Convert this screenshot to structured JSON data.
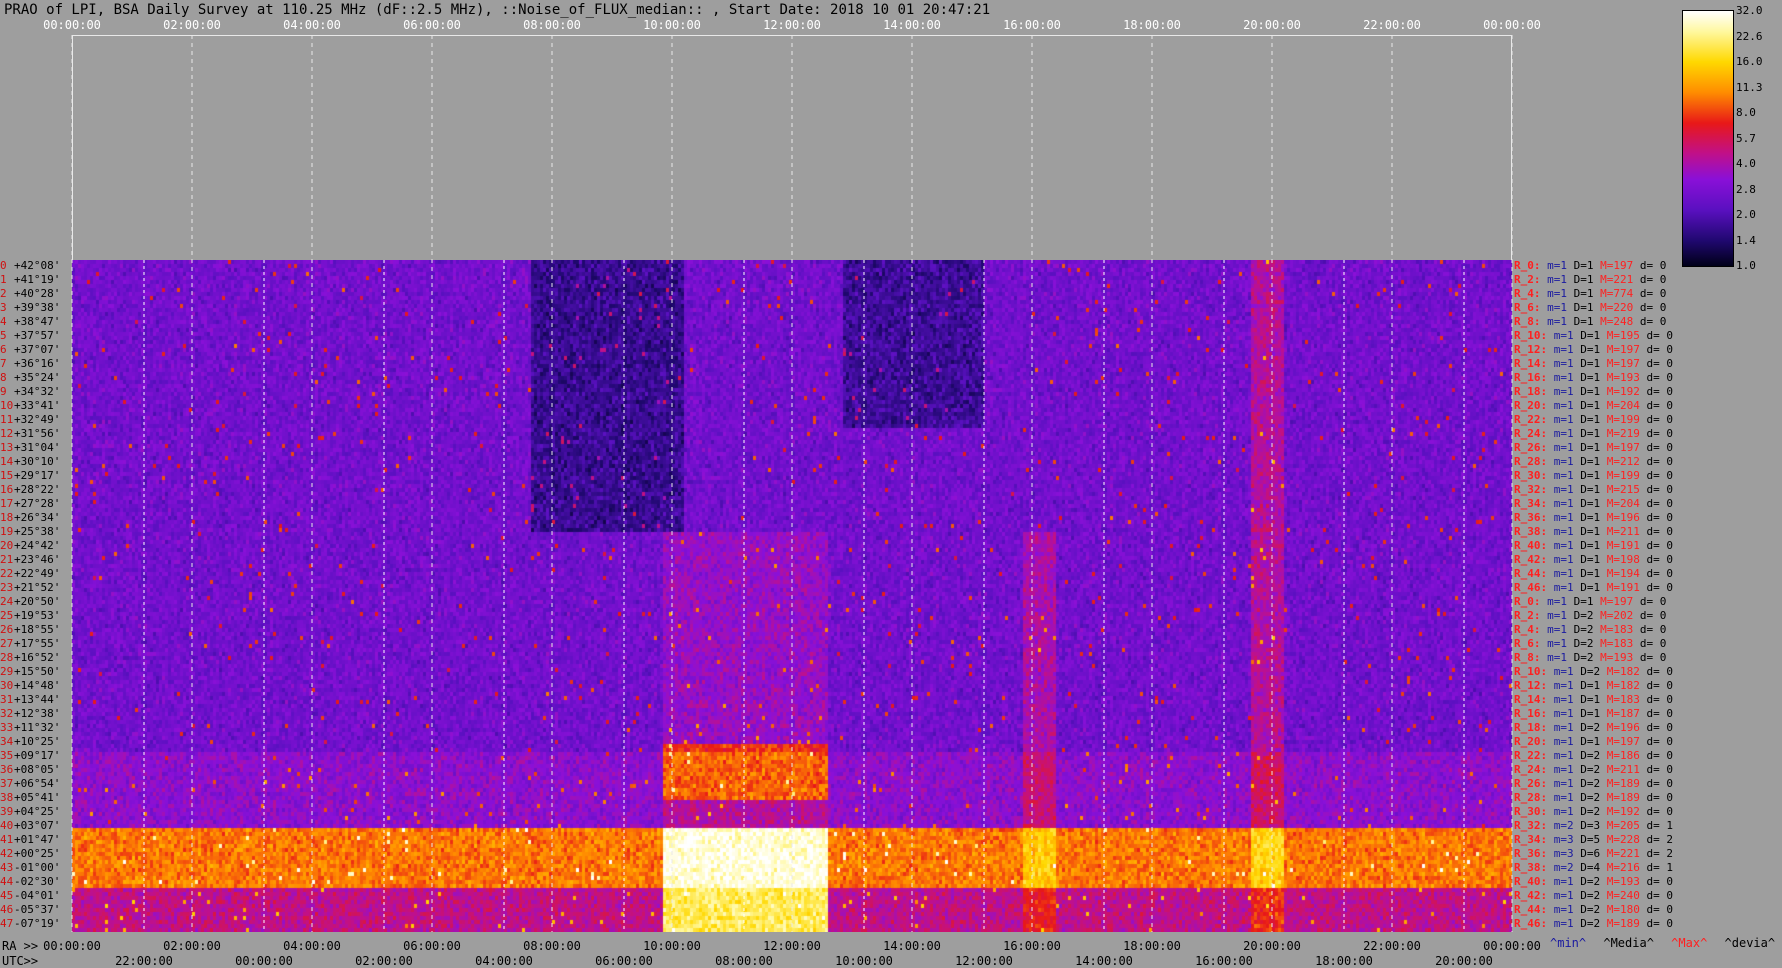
{
  "title": "PRAO of LPI, BSA Daily Survey at 110.25 MHz (dF::2.5 MHz), ::Noise_of_FLUX_median:: , Start Date: 2018 10 01 20:47:21",
  "top_axis": [
    "00:00:00",
    "02:00:00",
    "04:00:00",
    "06:00:00",
    "08:00:00",
    "10:00:00",
    "12:00:00",
    "14:00:00",
    "16:00:00",
    "18:00:00",
    "20:00:00",
    "22:00:00",
    "00:00:00"
  ],
  "ra_axis": {
    "label": "RA >>",
    "ticks": [
      "00:00:00",
      "02:00:00",
      "04:00:00",
      "06:00:00",
      "08:00:00",
      "10:00:00",
      "12:00:00",
      "14:00:00",
      "16:00:00",
      "18:00:00",
      "20:00:00",
      "22:00:00",
      "00:00:00"
    ]
  },
  "utc_axis": {
    "label": "UTC>>",
    "ticks": [
      "22:00:00",
      "00:00:00",
      "02:00:00",
      "04:00:00",
      "06:00:00",
      "08:00:00",
      "10:00:00",
      "12:00:00",
      "14:00:00",
      "16:00:00",
      "18:00:00",
      "20:00:00"
    ]
  },
  "colorbar": {
    "ticks": [
      "32.0",
      "22.6",
      "16.0",
      "11.3",
      "8.0",
      "5.7",
      "4.0",
      "2.8",
      "2.0",
      "1.4",
      "1.0"
    ]
  },
  "legend": {
    "min": "^min^",
    "media": "^Media^",
    "max": "^Max^",
    "devia": "^devia^"
  },
  "colors": {
    "background": "#9e9e9e",
    "row_label": "#ff2020",
    "min": "#1a1aa0",
    "max": "#ff2020"
  },
  "chart_data": {
    "type": "heatmap",
    "title": "PRAO of LPI, BSA Daily Survey at 110.25 MHz (dF::2.5 MHz), ::Noise_of_FLUX_median:: , Start Date: 2018 10 01 20:47:21",
    "xlabel": "RA >>",
    "x_range_hours": [
      0,
      24
    ],
    "colorscale": "log",
    "color_range": [
      1.0,
      32.0
    ],
    "declinations": [
      "+42°08'",
      "+41°19'",
      "+40°28'",
      "+39°38'",
      "+38°47'",
      "+37°57'",
      "+37°07'",
      "+36°16'",
      "+35°24'",
      "+34°32'",
      "+33°41'",
      "+32°49'",
      "+31°56'",
      "+31°04'",
      "+30°10'",
      "+29°17'",
      "+28°22'",
      "+27°28'",
      "+26°34'",
      "+25°38'",
      "+24°42'",
      "+23°46'",
      "+22°49'",
      "+21°52'",
      "+20°50'",
      "+19°53'",
      "+18°55'",
      "+17°55'",
      "+16°52'",
      "+15°50'",
      "+14°48'",
      "+13°44'",
      "+12°38'",
      "+11°32'",
      "+10°25'",
      "+09°17'",
      "+08°05'",
      "+06°54'",
      "+05°41'",
      "+04°25'",
      "+03°07'",
      "+01°47'",
      "+00°25'",
      "-01°00'",
      "-02°30'",
      "-04°01'",
      "-05°37'",
      "-07°19'"
    ],
    "row_stats": [
      {
        "label": "R_0:",
        "min": "m=1",
        "media": "D=1",
        "max": "M=197",
        "devia": "d= 0"
      },
      {
        "label": "R_2:",
        "min": "m=1",
        "media": "D=1",
        "max": "M=221",
        "devia": "d= 0"
      },
      {
        "label": "R_4:",
        "min": "m=1",
        "media": "D=1",
        "max": "M=774",
        "devia": "d= 0"
      },
      {
        "label": "R_6:",
        "min": "m=1",
        "media": "D=1",
        "max": "M=220",
        "devia": "d= 0"
      },
      {
        "label": "R_8:",
        "min": "m=1",
        "media": "D=1",
        "max": "M=248",
        "devia": "d= 0"
      },
      {
        "label": "R_10:",
        "min": "m=1",
        "media": "D=1",
        "max": "M=195",
        "devia": "d= 0"
      },
      {
        "label": "R_12:",
        "min": "m=1",
        "media": "D=1",
        "max": "M=197",
        "devia": "d= 0"
      },
      {
        "label": "R_14:",
        "min": "m=1",
        "media": "D=1",
        "max": "M=197",
        "devia": "d= 0"
      },
      {
        "label": "R_16:",
        "min": "m=1",
        "media": "D=1",
        "max": "M=193",
        "devia": "d= 0"
      },
      {
        "label": "R_18:",
        "min": "m=1",
        "media": "D=1",
        "max": "M=192",
        "devia": "d= 0"
      },
      {
        "label": "R_20:",
        "min": "m=1",
        "media": "D=1",
        "max": "M=204",
        "devia": "d= 0"
      },
      {
        "label": "R_22:",
        "min": "m=1",
        "media": "D=1",
        "max": "M=199",
        "devia": "d= 0"
      },
      {
        "label": "R_24:",
        "min": "m=1",
        "media": "D=1",
        "max": "M=219",
        "devia": "d= 0"
      },
      {
        "label": "R_26:",
        "min": "m=1",
        "media": "D=1",
        "max": "M=197",
        "devia": "d= 0"
      },
      {
        "label": "R_28:",
        "min": "m=1",
        "media": "D=1",
        "max": "M=212",
        "devia": "d= 0"
      },
      {
        "label": "R_30:",
        "min": "m=1",
        "media": "D=1",
        "max": "M=199",
        "devia": "d= 0"
      },
      {
        "label": "R_32:",
        "min": "m=1",
        "media": "D=1",
        "max": "M=215",
        "devia": "d= 0"
      },
      {
        "label": "R_34:",
        "min": "m=1",
        "media": "D=1",
        "max": "M=204",
        "devia": "d= 0"
      },
      {
        "label": "R_36:",
        "min": "m=1",
        "media": "D=1",
        "max": "M=196",
        "devia": "d= 0"
      },
      {
        "label": "R_38:",
        "min": "m=1",
        "media": "D=1",
        "max": "M=211",
        "devia": "d= 0"
      },
      {
        "label": "R_40:",
        "min": "m=1",
        "media": "D=1",
        "max": "M=191",
        "devia": "d= 0"
      },
      {
        "label": "R_42:",
        "min": "m=1",
        "media": "D=1",
        "max": "M=198",
        "devia": "d= 0"
      },
      {
        "label": "R_44:",
        "min": "m=1",
        "media": "D=1",
        "max": "M=194",
        "devia": "d= 0"
      },
      {
        "label": "R_46:",
        "min": "m=1",
        "media": "D=1",
        "max": "M=191",
        "devia": "d= 0"
      },
      {
        "label": "R_0:",
        "min": "m=1",
        "media": "D=1",
        "max": "M=197",
        "devia": "d= 0"
      },
      {
        "label": "R_2:",
        "min": "m=1",
        "media": "D=2",
        "max": "M=202",
        "devia": "d= 0"
      },
      {
        "label": "R_4:",
        "min": "m=1",
        "media": "D=2",
        "max": "M=183",
        "devia": "d= 0"
      },
      {
        "label": "R_6:",
        "min": "m=1",
        "media": "D=2",
        "max": "M=183",
        "devia": "d= 0"
      },
      {
        "label": "R_8:",
        "min": "m=1",
        "media": "D=2",
        "max": "M=193",
        "devia": "d= 0"
      },
      {
        "label": "R_10:",
        "min": "m=1",
        "media": "D=2",
        "max": "M=182",
        "devia": "d= 0"
      },
      {
        "label": "R_12:",
        "min": "m=1",
        "media": "D=1",
        "max": "M=182",
        "devia": "d= 0"
      },
      {
        "label": "R_14:",
        "min": "m=1",
        "media": "D=1",
        "max": "M=183",
        "devia": "d= 0"
      },
      {
        "label": "R_16:",
        "min": "m=1",
        "media": "D=1",
        "max": "M=187",
        "devia": "d= 0"
      },
      {
        "label": "R_18:",
        "min": "m=1",
        "media": "D=2",
        "max": "M=196",
        "devia": "d= 0"
      },
      {
        "label": "R_20:",
        "min": "m=1",
        "media": "D=1",
        "max": "M=197",
        "devia": "d= 0"
      },
      {
        "label": "R_22:",
        "min": "m=1",
        "media": "D=2",
        "max": "M=186",
        "devia": "d= 0"
      },
      {
        "label": "R_24:",
        "min": "m=1",
        "media": "D=2",
        "max": "M=211",
        "devia": "d= 0"
      },
      {
        "label": "R_26:",
        "min": "m=1",
        "media": "D=2",
        "max": "M=189",
        "devia": "d= 0"
      },
      {
        "label": "R_28:",
        "min": "m=1",
        "media": "D=2",
        "max": "M=189",
        "devia": "d= 0"
      },
      {
        "label": "R_30:",
        "min": "m=1",
        "media": "D=2",
        "max": "M=192",
        "devia": "d= 0"
      },
      {
        "label": "R_32:",
        "min": "m=2",
        "media": "D=3",
        "max": "M=205",
        "devia": "d= 1"
      },
      {
        "label": "R_34:",
        "min": "m=3",
        "media": "D=5",
        "max": "M=228",
        "devia": "d= 2"
      },
      {
        "label": "R_36:",
        "min": "m=3",
        "media": "D=6",
        "max": "M=221",
        "devia": "d= 2"
      },
      {
        "label": "R_38:",
        "min": "m=2",
        "media": "D=4",
        "max": "M=216",
        "devia": "d= 1"
      },
      {
        "label": "R_40:",
        "min": "m=1",
        "media": "D=2",
        "max": "M=193",
        "devia": "d= 0"
      },
      {
        "label": "R_42:",
        "min": "m=1",
        "media": "D=2",
        "max": "M=240",
        "devia": "d= 0"
      },
      {
        "label": "R_44:",
        "min": "m=1",
        "media": "D=2",
        "max": "M=180",
        "devia": "d= 0"
      },
      {
        "label": "R_46:",
        "min": "m=1",
        "media": "D=2",
        "max": "M=189",
        "devia": "d= 0"
      }
    ]
  }
}
